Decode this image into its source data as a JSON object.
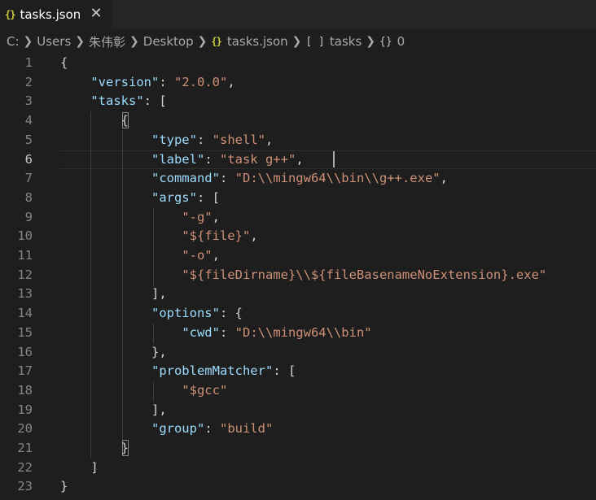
{
  "tab": {
    "icon": "{}",
    "title": "tasks.json",
    "close": "✕"
  },
  "breadcrumb": {
    "items": [
      "C:",
      "Users",
      "朱伟彰",
      "Desktop"
    ],
    "file_icon": "{}",
    "file": "tasks.json",
    "array_icon": "[ ]",
    "array": "tasks",
    "object_icon": "{}",
    "object": "0"
  },
  "editor": {
    "active_line": 6,
    "lines": [
      {
        "num": "1",
        "tokens": [
          {
            "t": "p",
            "v": "{"
          }
        ]
      },
      {
        "num": "2",
        "tokens": [
          {
            "t": "p",
            "v": "    "
          },
          {
            "t": "k",
            "v": "\"version\""
          },
          {
            "t": "p",
            "v": ": "
          },
          {
            "t": "s",
            "v": "\"2.0.0\""
          },
          {
            "t": "p",
            "v": ","
          }
        ]
      },
      {
        "num": "3",
        "tokens": [
          {
            "t": "p",
            "v": "    "
          },
          {
            "t": "k",
            "v": "\"tasks\""
          },
          {
            "t": "p",
            "v": ": ["
          }
        ]
      },
      {
        "num": "4",
        "tokens": [
          {
            "t": "p",
            "v": "        {"
          }
        ]
      },
      {
        "num": "5",
        "tokens": [
          {
            "t": "p",
            "v": "            "
          },
          {
            "t": "k",
            "v": "\"type\""
          },
          {
            "t": "p",
            "v": ": "
          },
          {
            "t": "s",
            "v": "\"shell\""
          },
          {
            "t": "p",
            "v": ","
          }
        ]
      },
      {
        "num": "6",
        "tokens": [
          {
            "t": "p",
            "v": "            "
          },
          {
            "t": "k",
            "v": "\"label\""
          },
          {
            "t": "p",
            "v": ": "
          },
          {
            "t": "s",
            "v": "\"task g++\""
          },
          {
            "t": "p",
            "v": ","
          }
        ]
      },
      {
        "num": "7",
        "tokens": [
          {
            "t": "p",
            "v": "            "
          },
          {
            "t": "k",
            "v": "\"command\""
          },
          {
            "t": "p",
            "v": ": "
          },
          {
            "t": "s",
            "v": "\"D:\\\\mingw64\\\\bin\\\\g++.exe\""
          },
          {
            "t": "p",
            "v": ","
          }
        ]
      },
      {
        "num": "8",
        "tokens": [
          {
            "t": "p",
            "v": "            "
          },
          {
            "t": "k",
            "v": "\"args\""
          },
          {
            "t": "p",
            "v": ": ["
          }
        ]
      },
      {
        "num": "9",
        "tokens": [
          {
            "t": "p",
            "v": "                "
          },
          {
            "t": "s",
            "v": "\"-g\""
          },
          {
            "t": "p",
            "v": ","
          }
        ]
      },
      {
        "num": "10",
        "tokens": [
          {
            "t": "p",
            "v": "                "
          },
          {
            "t": "s",
            "v": "\"${file}\""
          },
          {
            "t": "p",
            "v": ","
          }
        ]
      },
      {
        "num": "11",
        "tokens": [
          {
            "t": "p",
            "v": "                "
          },
          {
            "t": "s",
            "v": "\"-o\""
          },
          {
            "t": "p",
            "v": ","
          }
        ]
      },
      {
        "num": "12",
        "tokens": [
          {
            "t": "p",
            "v": "                "
          },
          {
            "t": "s",
            "v": "\"${fileDirname}\\\\${fileBasenameNoExtension}.exe\""
          }
        ]
      },
      {
        "num": "13",
        "tokens": [
          {
            "t": "p",
            "v": "            ],"
          }
        ]
      },
      {
        "num": "14",
        "tokens": [
          {
            "t": "p",
            "v": "            "
          },
          {
            "t": "k",
            "v": "\"options\""
          },
          {
            "t": "p",
            "v": ": {"
          }
        ]
      },
      {
        "num": "15",
        "tokens": [
          {
            "t": "p",
            "v": "                "
          },
          {
            "t": "k",
            "v": "\"cwd\""
          },
          {
            "t": "p",
            "v": ": "
          },
          {
            "t": "s",
            "v": "\"D:\\\\mingw64\\\\bin\""
          }
        ]
      },
      {
        "num": "16",
        "tokens": [
          {
            "t": "p",
            "v": "            },"
          }
        ]
      },
      {
        "num": "17",
        "tokens": [
          {
            "t": "p",
            "v": "            "
          },
          {
            "t": "k",
            "v": "\"problemMatcher\""
          },
          {
            "t": "p",
            "v": ": ["
          }
        ]
      },
      {
        "num": "18",
        "tokens": [
          {
            "t": "p",
            "v": "                "
          },
          {
            "t": "s",
            "v": "\"$gcc\""
          }
        ]
      },
      {
        "num": "19",
        "tokens": [
          {
            "t": "p",
            "v": "            ],"
          }
        ]
      },
      {
        "num": "20",
        "tokens": [
          {
            "t": "p",
            "v": "            "
          },
          {
            "t": "k",
            "v": "\"group\""
          },
          {
            "t": "p",
            "v": ": "
          },
          {
            "t": "s",
            "v": "\"build\""
          }
        ]
      },
      {
        "num": "21",
        "tokens": [
          {
            "t": "p",
            "v": "        }"
          }
        ]
      },
      {
        "num": "22",
        "tokens": [
          {
            "t": "p",
            "v": "    ]"
          }
        ]
      },
      {
        "num": "23",
        "tokens": [
          {
            "t": "p",
            "v": "}"
          }
        ]
      }
    ]
  }
}
